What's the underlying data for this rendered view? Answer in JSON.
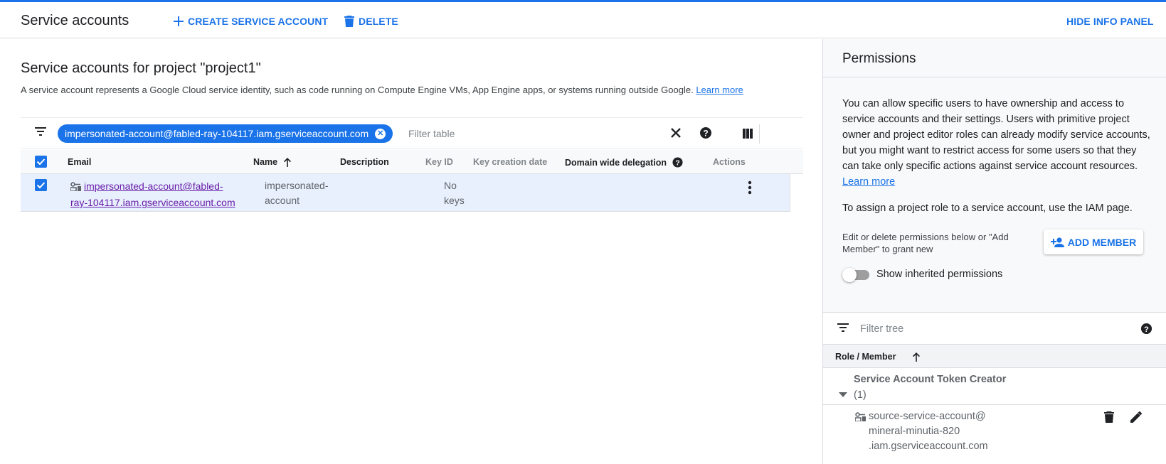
{
  "header": {
    "title": "Service accounts",
    "create_label": "CREATE SERVICE ACCOUNT",
    "delete_label": "DELETE",
    "hide_panel_label": "HIDE INFO PANEL"
  },
  "main": {
    "heading": "Service accounts for project \"project1\"",
    "description": "A service account represents a Google Cloud service identity, such as code running on Compute Engine VMs, App Engine apps, or systems running outside Google.",
    "learn_more": "Learn more",
    "filter": {
      "chip_label": "impersonated-account@fabled-ray-104117.iam.gserviceaccount.com",
      "placeholder": "Filter table"
    },
    "columns": [
      "Email",
      "Name",
      "Description",
      "Key ID",
      "Key creation date",
      "Domain wide delegation",
      "Actions"
    ],
    "rows": [
      {
        "email_line1": "impersonated-account@fabled-",
        "email_line2": "ray-104117.iam.gserviceaccount.com",
        "name_line1": "impersonated-",
        "name_line2": "account",
        "description": "",
        "key_line1": "No",
        "key_line2": "keys",
        "selected": true
      }
    ]
  },
  "panel": {
    "title": "Permissions",
    "intro": "You can allow specific users to have ownership and access to service accounts and their settings. Users with primitive project owner and project editor roles can already modify service accounts, but you might want to restrict access for some users so that they can take only specific actions against service account resources.",
    "learn_more": "Learn more",
    "assign_note": "To assign a project role to a service account, use the IAM page.",
    "edit_note": "Edit or delete permissions below or \"Add Member\" to grant new",
    "add_member_label": "ADD MEMBER",
    "toggle_label": "Show inherited permissions",
    "toggle_on": false,
    "tree_placeholder": "Filter tree",
    "role_header": "Role / Member",
    "roles": [
      {
        "name": "Service Account Token Creator",
        "count": "(1)",
        "members": [
          {
            "line1": "source-service-account@",
            "line2": "mineral-minutia-820",
            "line3": ".iam.gserviceaccount.com"
          }
        ]
      }
    ]
  },
  "colors": {
    "accent": "#1a73e8",
    "link_visited": "#681da8",
    "row_selected": "#e8f0fe"
  }
}
